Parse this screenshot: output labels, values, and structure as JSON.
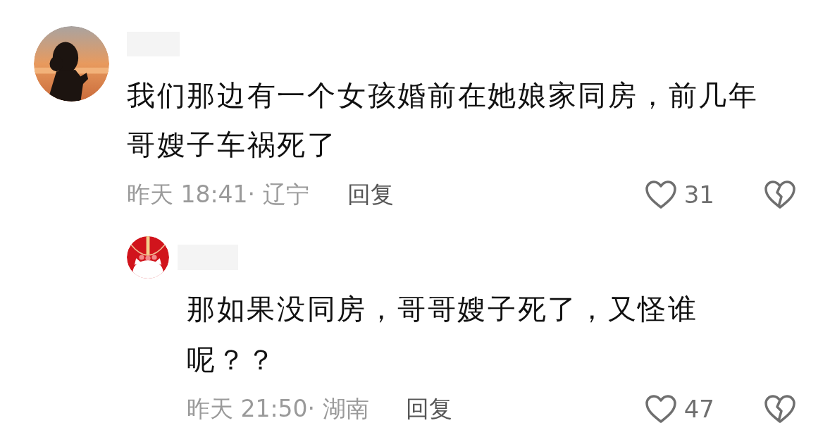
{
  "comments": [
    {
      "text": "我们那边有一个女孩婚前在她娘家同房，前几年哥嫂子车祸死了",
      "meta": "昨天 18:41· 辽宁",
      "reply_label": "回复",
      "likes": "31",
      "replies": [
        {
          "text": "那如果没同房，哥哥嫂子死了，又怪谁呢？？",
          "meta": "昨天 21:50· 湖南",
          "reply_label": "回复",
          "likes": "47"
        }
      ]
    }
  ]
}
